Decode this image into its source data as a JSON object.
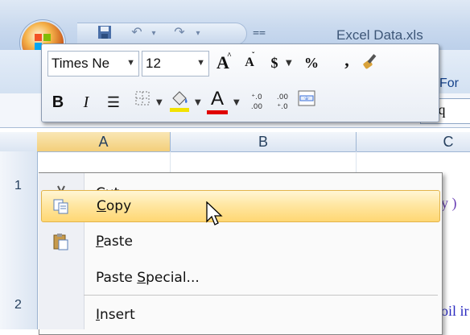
{
  "window": {
    "title": "Excel Data.xls"
  },
  "ribbon": {
    "tab_partial": "For"
  },
  "formula_bar": {
    "value_partial": "ll q"
  },
  "sheet": {
    "columns": [
      "A",
      "B",
      "C"
    ],
    "row_numbers": [
      "1",
      "2"
    ],
    "cell_fragments": {
      "c1": "y )",
      "c2": "oil ir"
    }
  },
  "mini_toolbar": {
    "font_name": "Times Ne",
    "font_size": "12",
    "grow_font": "A",
    "shrink_font": "A",
    "currency": "$",
    "percent": "%",
    "comma": ",",
    "bold": "B",
    "italic": "I",
    "font_color_letter": "A",
    "increase_decimal": "⁺.0 .00",
    "decrease_decimal": ".00 ⁺.0",
    "colors": {
      "highlight": "#f2e200",
      "font_color": "#e00000"
    }
  },
  "context_menu": {
    "items": [
      {
        "before": "Cu",
        "mnemonic": "t",
        "after": "",
        "icon": "scissors-icon"
      },
      {
        "before": "",
        "mnemonic": "C",
        "after": "opy",
        "icon": "copy-icon",
        "highlighted": true
      },
      {
        "before": "",
        "mnemonic": "P",
        "after": "aste",
        "icon": "paste-icon"
      },
      {
        "before": "Paste ",
        "mnemonic": "S",
        "after": "pecial...",
        "icon": ""
      },
      {
        "before": "",
        "mnemonic": "I",
        "after": "nsert",
        "icon": ""
      }
    ]
  }
}
